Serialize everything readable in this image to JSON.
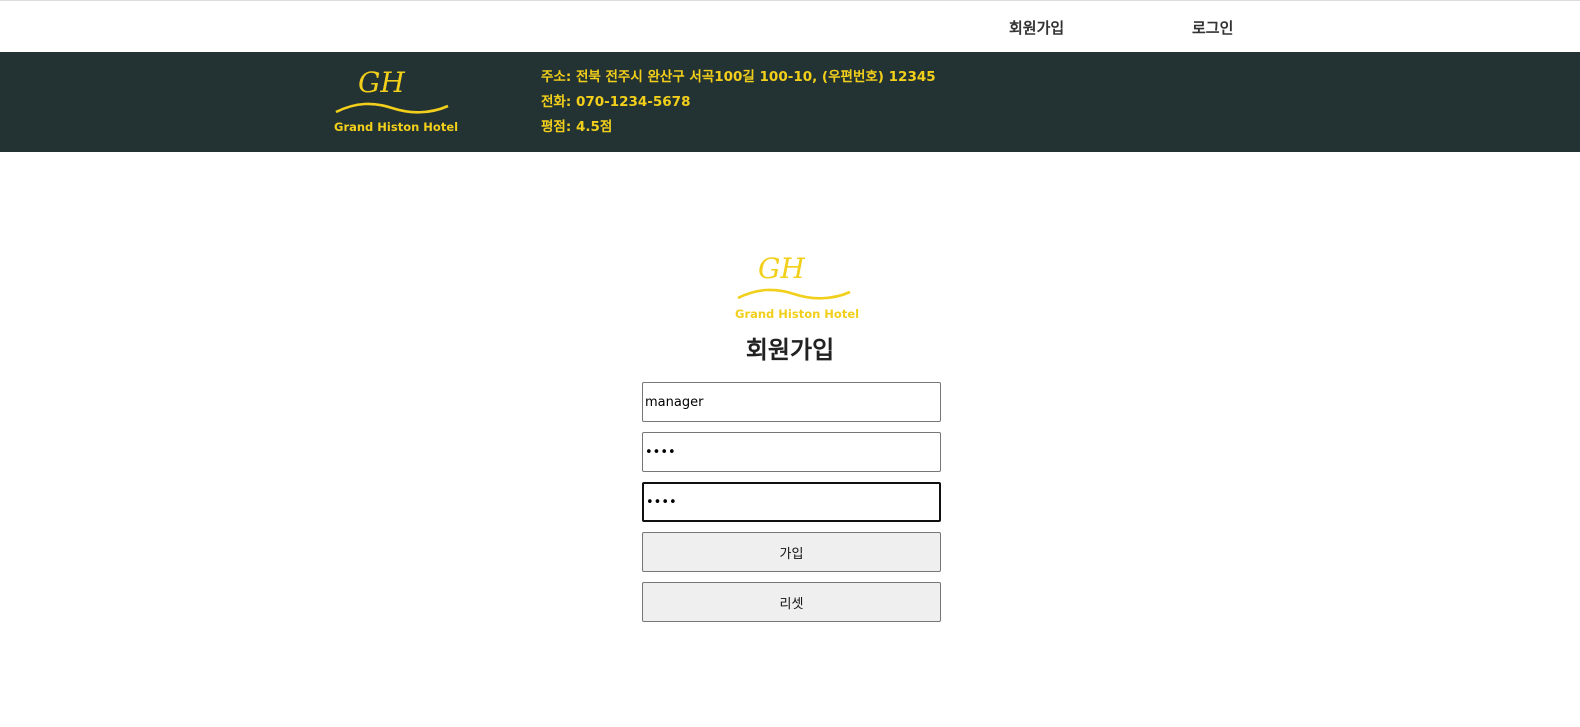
{
  "nav": {
    "signup": "회원가입",
    "login": "로그인"
  },
  "brand": {
    "monogram": "GH",
    "name": "Grand Histon Hotel",
    "color": "#f2cf1a",
    "bar_color": "#233334"
  },
  "info": {
    "address": "주소: 전북 전주시 완산구 서곡100길 100-10, (우편번호) 12345",
    "phone": "전화: 070-1234-5678",
    "rating": "평점: 4.5점"
  },
  "form": {
    "title": "회원가입",
    "username_value": "manager",
    "password_value": "1234",
    "password_confirm_value": "1234",
    "submit_label": "가입",
    "reset_label": "리셋"
  }
}
